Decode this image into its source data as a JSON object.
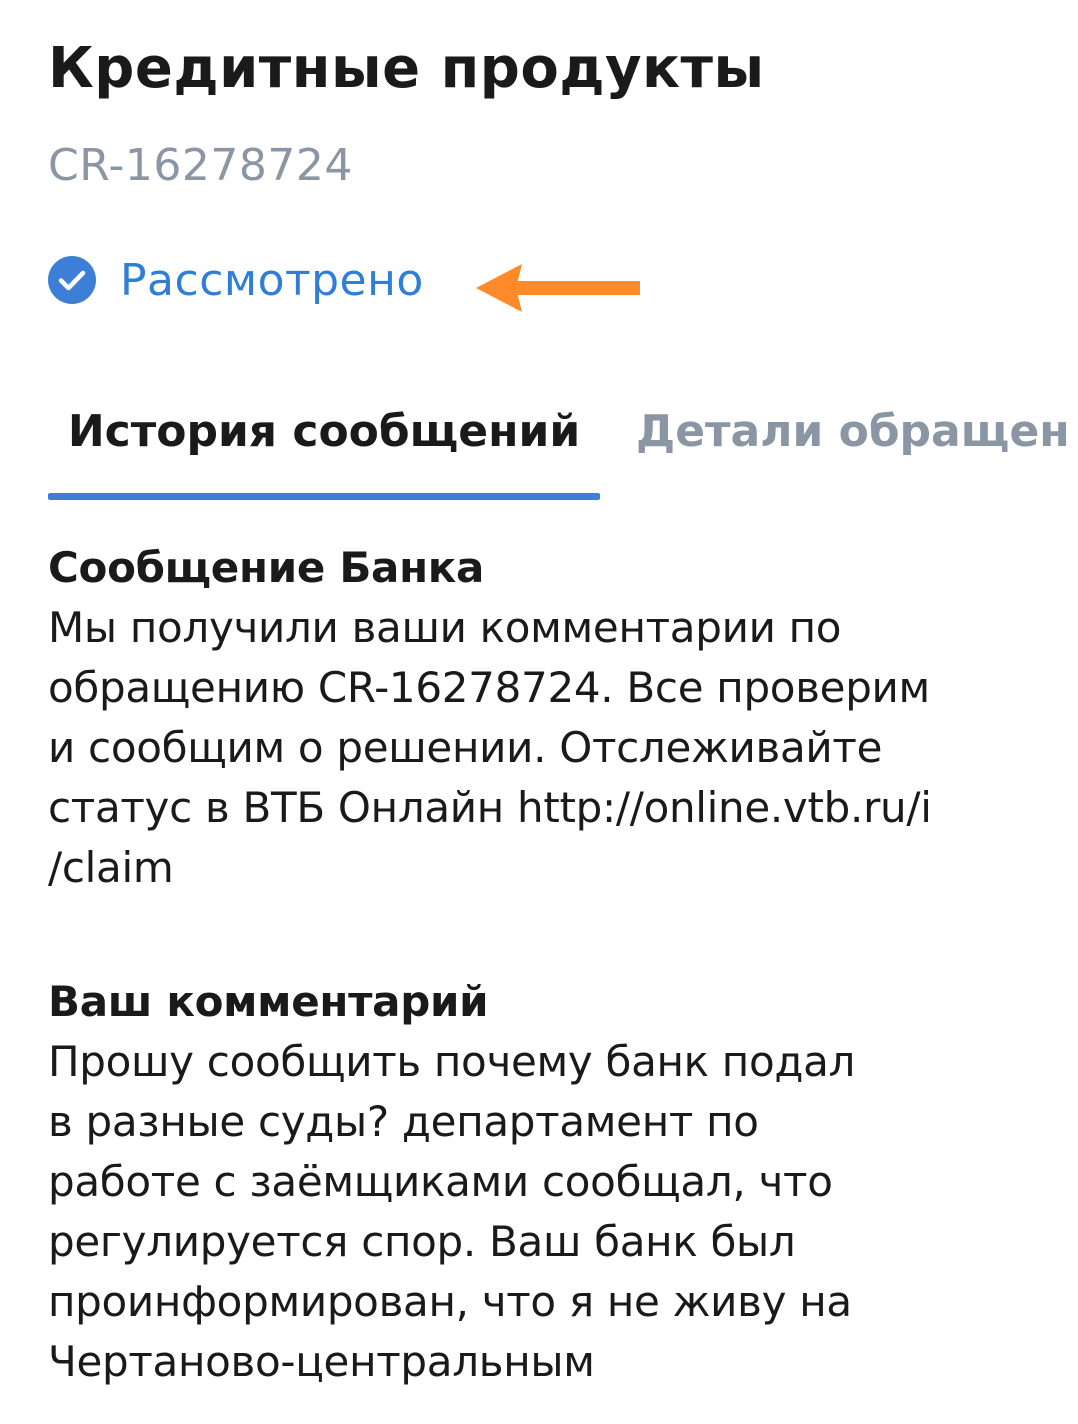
{
  "header": {
    "title": "Кредитные продукты",
    "request_id": "CR-16278724"
  },
  "status": {
    "icon": "check-circle-icon",
    "label": "Рассмотрено",
    "color": "#2f7fd9"
  },
  "annotation": {
    "icon": "arrow-left-icon",
    "color": "#ff8a2a"
  },
  "tabs": [
    {
      "label": "История сообщений",
      "active": true
    },
    {
      "label": "Детали обращен",
      "active": false
    }
  ],
  "messages": [
    {
      "title": "Сообщение Банка",
      "lines": [
        "Мы получили ваши комментарии по",
        "обращению CR-16278724. Все проверим",
        "и сообщим о решении. Отслеживайте",
        "статус в ВТБ Онлайн http://online.vtb.ru/i",
        "/claim"
      ]
    },
    {
      "title": "Ваш комментарий",
      "lines": [
        "Прошу сообщить почему банк подал",
        "в разные суды? департамент по",
        "работе с заёмщиками сообщал, что",
        "регулируется спор. Ваш банк был",
        "проинформирован, что я не живу на",
        "Чертаново-центральным"
      ]
    }
  ],
  "colors": {
    "accent": "#3d7fd6",
    "muted_text": "#8a96a3",
    "primary_text": "#1a1a1a"
  }
}
